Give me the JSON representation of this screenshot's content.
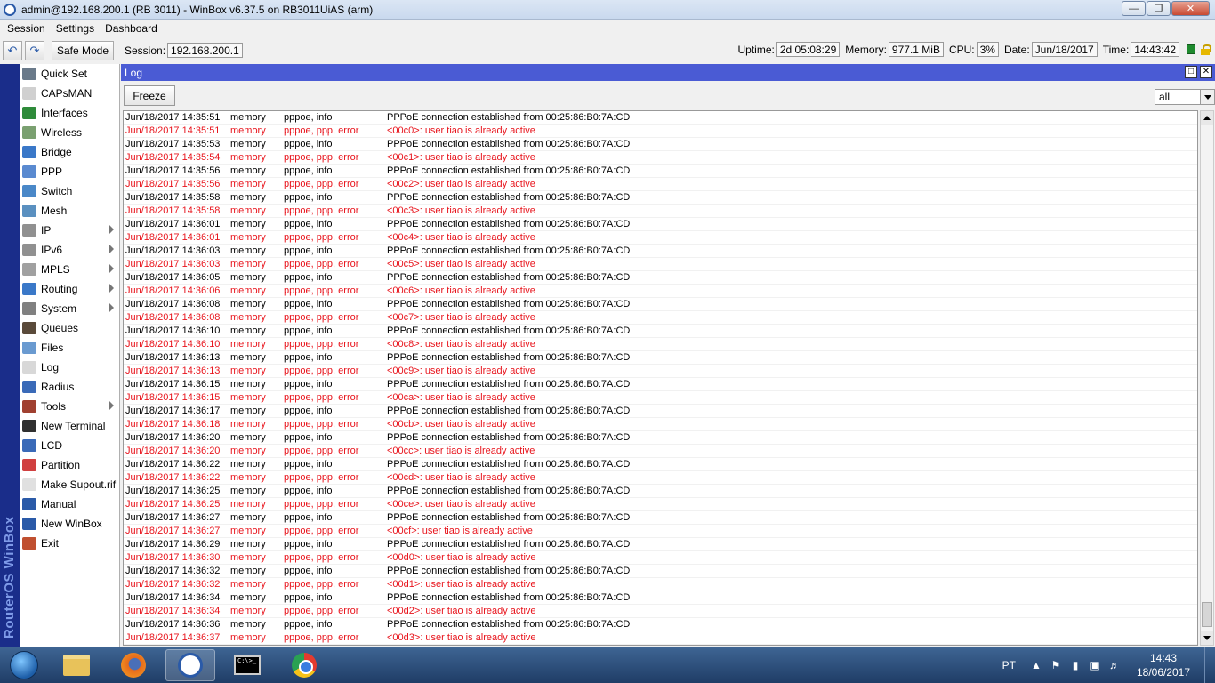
{
  "window": {
    "title": "admin@192.168.200.1 (RB 3011) - WinBox v6.37.5 on RB3011UiAS (arm)"
  },
  "menu": [
    "Session",
    "Settings",
    "Dashboard"
  ],
  "toolbar": {
    "undo_icon": "undo-icon",
    "redo_icon": "redo-icon",
    "safe_mode_label": "Safe Mode",
    "session_label": "Session:",
    "session_value": "192.168.200.1",
    "uptime_label": "Uptime:",
    "uptime_value": "2d 05:08:29",
    "memory_label": "Memory:",
    "memory_value": "977.1 MiB",
    "cpu_label": "CPU:",
    "cpu_value": "3%",
    "date_label": "Date:",
    "date_value": "Jun/18/2017",
    "time_label": "Time:",
    "time_value": "14:43:42"
  },
  "brand": "RouterOS WinBox",
  "sidebar": [
    {
      "label": "Quick Set",
      "icon": "quick-set-icon",
      "color": "#6a7a8a",
      "submenu": false
    },
    {
      "label": "CAPsMAN",
      "icon": "capsman-icon",
      "color": "#d0d0d0",
      "submenu": false
    },
    {
      "label": "Interfaces",
      "icon": "interfaces-icon",
      "color": "#2e8b3a",
      "submenu": false
    },
    {
      "label": "Wireless",
      "icon": "wireless-icon",
      "color": "#7aa070",
      "submenu": false
    },
    {
      "label": "Bridge",
      "icon": "bridge-icon",
      "color": "#3a78c8",
      "submenu": false
    },
    {
      "label": "PPP",
      "icon": "ppp-icon",
      "color": "#5a8ad0",
      "submenu": false
    },
    {
      "label": "Switch",
      "icon": "switch-icon",
      "color": "#4a88c8",
      "submenu": false
    },
    {
      "label": "Mesh",
      "icon": "mesh-icon",
      "color": "#5a90c0",
      "submenu": false
    },
    {
      "label": "IP",
      "icon": "ip-icon",
      "color": "#909090",
      "submenu": true
    },
    {
      "label": "IPv6",
      "icon": "ipv6-icon",
      "color": "#909090",
      "submenu": true
    },
    {
      "label": "MPLS",
      "icon": "mpls-icon",
      "color": "#a0a0a0",
      "submenu": true
    },
    {
      "label": "Routing",
      "icon": "routing-icon",
      "color": "#3a78c8",
      "submenu": true
    },
    {
      "label": "System",
      "icon": "system-icon",
      "color": "#808080",
      "submenu": true
    },
    {
      "label": "Queues",
      "icon": "queues-icon",
      "color": "#5a4a3a",
      "submenu": false
    },
    {
      "label": "Files",
      "icon": "files-icon",
      "color": "#6a9ad0",
      "submenu": false
    },
    {
      "label": "Log",
      "icon": "log-icon",
      "color": "#d8d8d8",
      "submenu": false
    },
    {
      "label": "Radius",
      "icon": "radius-icon",
      "color": "#3a6ab8",
      "submenu": false
    },
    {
      "label": "Tools",
      "icon": "tools-icon",
      "color": "#a04030",
      "submenu": true
    },
    {
      "label": "New Terminal",
      "icon": "terminal-icon",
      "color": "#303030",
      "submenu": false
    },
    {
      "label": "LCD",
      "icon": "lcd-icon",
      "color": "#3a6ab8",
      "submenu": false
    },
    {
      "label": "Partition",
      "icon": "partition-icon",
      "color": "#d04040",
      "submenu": false
    },
    {
      "label": "Make Supout.rif",
      "icon": "supout-icon",
      "color": "#e0e0e0",
      "submenu": false
    },
    {
      "label": "Manual",
      "icon": "manual-icon",
      "color": "#2a5aa8",
      "submenu": false
    },
    {
      "label": "New WinBox",
      "icon": "winbox-icon",
      "color": "#2a5aa8",
      "submenu": false
    },
    {
      "label": "Exit",
      "icon": "exit-icon",
      "color": "#c05030",
      "submenu": false
    }
  ],
  "log": {
    "title": "Log",
    "freeze_label": "Freeze",
    "filter_value": "all",
    "error_color": "#e8141c",
    "rows": [
      {
        "time": "Jun/18/2017 14:35:51",
        "buffer": "memory",
        "topics": "pppoe, info",
        "message": "PPPoE connection established from 00:25:86:B0:7A:CD",
        "error": false
      },
      {
        "time": "Jun/18/2017 14:35:51",
        "buffer": "memory",
        "topics": "pppoe, ppp, error",
        "message": "<00c0>: user tiao is already active",
        "error": true
      },
      {
        "time": "Jun/18/2017 14:35:53",
        "buffer": "memory",
        "topics": "pppoe, info",
        "message": "PPPoE connection established from 00:25:86:B0:7A:CD",
        "error": false
      },
      {
        "time": "Jun/18/2017 14:35:54",
        "buffer": "memory",
        "topics": "pppoe, ppp, error",
        "message": "<00c1>: user tiao is already active",
        "error": true
      },
      {
        "time": "Jun/18/2017 14:35:56",
        "buffer": "memory",
        "topics": "pppoe, info",
        "message": "PPPoE connection established from 00:25:86:B0:7A:CD",
        "error": false
      },
      {
        "time": "Jun/18/2017 14:35:56",
        "buffer": "memory",
        "topics": "pppoe, ppp, error",
        "message": "<00c2>: user tiao is already active",
        "error": true
      },
      {
        "time": "Jun/18/2017 14:35:58",
        "buffer": "memory",
        "topics": "pppoe, info",
        "message": "PPPoE connection established from 00:25:86:B0:7A:CD",
        "error": false
      },
      {
        "time": "Jun/18/2017 14:35:58",
        "buffer": "memory",
        "topics": "pppoe, ppp, error",
        "message": "<00c3>: user tiao is already active",
        "error": true
      },
      {
        "time": "Jun/18/2017 14:36:01",
        "buffer": "memory",
        "topics": "pppoe, info",
        "message": "PPPoE connection established from 00:25:86:B0:7A:CD",
        "error": false
      },
      {
        "time": "Jun/18/2017 14:36:01",
        "buffer": "memory",
        "topics": "pppoe, ppp, error",
        "message": "<00c4>: user tiao is already active",
        "error": true
      },
      {
        "time": "Jun/18/2017 14:36:03",
        "buffer": "memory",
        "topics": "pppoe, info",
        "message": "PPPoE connection established from 00:25:86:B0:7A:CD",
        "error": false
      },
      {
        "time": "Jun/18/2017 14:36:03",
        "buffer": "memory",
        "topics": "pppoe, ppp, error",
        "message": "<00c5>: user tiao is already active",
        "error": true
      },
      {
        "time": "Jun/18/2017 14:36:05",
        "buffer": "memory",
        "topics": "pppoe, info",
        "message": "PPPoE connection established from 00:25:86:B0:7A:CD",
        "error": false
      },
      {
        "time": "Jun/18/2017 14:36:06",
        "buffer": "memory",
        "topics": "pppoe, ppp, error",
        "message": "<00c6>: user tiao is already active",
        "error": true
      },
      {
        "time": "Jun/18/2017 14:36:08",
        "buffer": "memory",
        "topics": "pppoe, info",
        "message": "PPPoE connection established from 00:25:86:B0:7A:CD",
        "error": false
      },
      {
        "time": "Jun/18/2017 14:36:08",
        "buffer": "memory",
        "topics": "pppoe, ppp, error",
        "message": "<00c7>: user tiao is already active",
        "error": true
      },
      {
        "time": "Jun/18/2017 14:36:10",
        "buffer": "memory",
        "topics": "pppoe, info",
        "message": "PPPoE connection established from 00:25:86:B0:7A:CD",
        "error": false
      },
      {
        "time": "Jun/18/2017 14:36:10",
        "buffer": "memory",
        "topics": "pppoe, ppp, error",
        "message": "<00c8>: user tiao is already active",
        "error": true
      },
      {
        "time": "Jun/18/2017 14:36:13",
        "buffer": "memory",
        "topics": "pppoe, info",
        "message": "PPPoE connection established from 00:25:86:B0:7A:CD",
        "error": false
      },
      {
        "time": "Jun/18/2017 14:36:13",
        "buffer": "memory",
        "topics": "pppoe, ppp, error",
        "message": "<00c9>: user tiao is already active",
        "error": true
      },
      {
        "time": "Jun/18/2017 14:36:15",
        "buffer": "memory",
        "topics": "pppoe, info",
        "message": "PPPoE connection established from 00:25:86:B0:7A:CD",
        "error": false
      },
      {
        "time": "Jun/18/2017 14:36:15",
        "buffer": "memory",
        "topics": "pppoe, ppp, error",
        "message": "<00ca>: user tiao is already active",
        "error": true
      },
      {
        "time": "Jun/18/2017 14:36:17",
        "buffer": "memory",
        "topics": "pppoe, info",
        "message": "PPPoE connection established from 00:25:86:B0:7A:CD",
        "error": false
      },
      {
        "time": "Jun/18/2017 14:36:18",
        "buffer": "memory",
        "topics": "pppoe, ppp, error",
        "message": "<00cb>: user tiao is already active",
        "error": true
      },
      {
        "time": "Jun/18/2017 14:36:20",
        "buffer": "memory",
        "topics": "pppoe, info",
        "message": "PPPoE connection established from 00:25:86:B0:7A:CD",
        "error": false
      },
      {
        "time": "Jun/18/2017 14:36:20",
        "buffer": "memory",
        "topics": "pppoe, ppp, error",
        "message": "<00cc>: user tiao is already active",
        "error": true
      },
      {
        "time": "Jun/18/2017 14:36:22",
        "buffer": "memory",
        "topics": "pppoe, info",
        "message": "PPPoE connection established from 00:25:86:B0:7A:CD",
        "error": false
      },
      {
        "time": "Jun/18/2017 14:36:22",
        "buffer": "memory",
        "topics": "pppoe, ppp, error",
        "message": "<00cd>: user tiao is already active",
        "error": true
      },
      {
        "time": "Jun/18/2017 14:36:25",
        "buffer": "memory",
        "topics": "pppoe, info",
        "message": "PPPoE connection established from 00:25:86:B0:7A:CD",
        "error": false
      },
      {
        "time": "Jun/18/2017 14:36:25",
        "buffer": "memory",
        "topics": "pppoe, ppp, error",
        "message": "<00ce>: user tiao is already active",
        "error": true
      },
      {
        "time": "Jun/18/2017 14:36:27",
        "buffer": "memory",
        "topics": "pppoe, info",
        "message": "PPPoE connection established from 00:25:86:B0:7A:CD",
        "error": false
      },
      {
        "time": "Jun/18/2017 14:36:27",
        "buffer": "memory",
        "topics": "pppoe, ppp, error",
        "message": "<00cf>: user tiao is already active",
        "error": true
      },
      {
        "time": "Jun/18/2017 14:36:29",
        "buffer": "memory",
        "topics": "pppoe, info",
        "message": "PPPoE connection established from 00:25:86:B0:7A:CD",
        "error": false
      },
      {
        "time": "Jun/18/2017 14:36:30",
        "buffer": "memory",
        "topics": "pppoe, ppp, error",
        "message": "<00d0>: user tiao is already active",
        "error": true
      },
      {
        "time": "Jun/18/2017 14:36:32",
        "buffer": "memory",
        "topics": "pppoe, info",
        "message": "PPPoE connection established from 00:25:86:B0:7A:CD",
        "error": false
      },
      {
        "time": "Jun/18/2017 14:36:32",
        "buffer": "memory",
        "topics": "pppoe, ppp, error",
        "message": "<00d1>: user tiao is already active",
        "error": true
      },
      {
        "time": "Jun/18/2017 14:36:34",
        "buffer": "memory",
        "topics": "pppoe, info",
        "message": "PPPoE connection established from 00:25:86:B0:7A:CD",
        "error": false
      },
      {
        "time": "Jun/18/2017 14:36:34",
        "buffer": "memory",
        "topics": "pppoe, ppp, error",
        "message": "<00d2>: user tiao is already active",
        "error": true
      },
      {
        "time": "Jun/18/2017 14:36:36",
        "buffer": "memory",
        "topics": "pppoe, info",
        "message": "PPPoE connection established from 00:25:86:B0:7A:CD",
        "error": false
      },
      {
        "time": "Jun/18/2017 14:36:37",
        "buffer": "memory",
        "topics": "pppoe, ppp, error",
        "message": "<00d3>: user tiao is already active",
        "error": true
      }
    ]
  },
  "taskbar": {
    "apps": [
      {
        "name": "explorer-icon",
        "active": false
      },
      {
        "name": "firefox-icon",
        "active": false
      },
      {
        "name": "winbox-app-icon",
        "active": true
      },
      {
        "name": "cmd-icon",
        "active": false
      },
      {
        "name": "chrome-icon",
        "active": false
      }
    ],
    "cmd_text": "C:\\>_",
    "lang": "PT",
    "clock_time": "14:43",
    "clock_date": "18/06/2017"
  }
}
